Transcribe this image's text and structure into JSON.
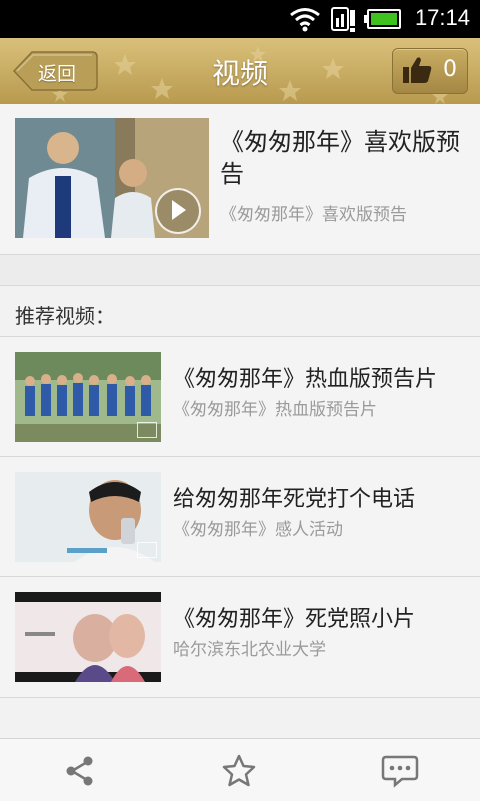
{
  "status_bar": {
    "time": "17:14"
  },
  "header": {
    "title": "视频",
    "back_label": "返回",
    "like_count": "0"
  },
  "featured": {
    "title": "《匆匆那年》喜欢版预告",
    "subtitle": "《匆匆那年》喜欢版预告"
  },
  "recommend_label": "推荐视频：",
  "items": [
    {
      "title": "《匆匆那年》热血版预告片",
      "subtitle": "《匆匆那年》热血版预告片"
    },
    {
      "title": "给匆匆那年死党打个电话",
      "subtitle": "《匆匆那年》感人活动"
    },
    {
      "title": "《匆匆那年》死党照小片",
      "subtitle": "哈尔滨东北农业大学"
    }
  ],
  "bottom_bar": {
    "icons": [
      "share-icon",
      "star-icon",
      "comment-icon"
    ]
  },
  "colors": {
    "header_gold": "#c8ab62",
    "background": "#f2f2f2",
    "subtitle_gray": "#9a9a9a"
  }
}
